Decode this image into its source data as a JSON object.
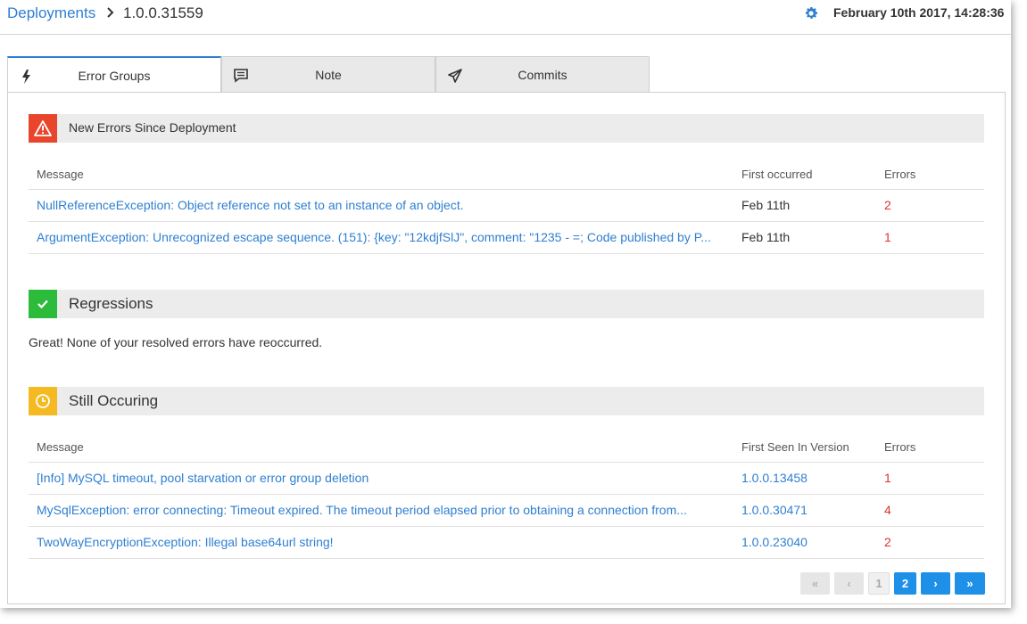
{
  "header": {
    "breadcrumb_root": "Deployments",
    "breadcrumb_current": "1.0.0.31559",
    "settings_icon": "gear-icon",
    "date": "February 10th 2017, 14:28:36"
  },
  "tabs": [
    {
      "label": "Error Groups",
      "icon": "lightning-icon",
      "active": true
    },
    {
      "label": "Note",
      "icon": "comment-icon",
      "active": false
    },
    {
      "label": "Commits",
      "icon": "paper-plane-icon",
      "active": false
    }
  ],
  "new_errors": {
    "title": "New Errors Since Deployment",
    "icon_color": "#e8452c",
    "columns": [
      "Message",
      "First occurred",
      "Errors"
    ],
    "rows": [
      {
        "message": "NullReferenceException: Object reference not set to an instance of an object.",
        "first": "Feb 11th",
        "errors": "2"
      },
      {
        "message": "ArgumentException: Unrecognized escape sequence. (151): {key: \"12kdjfSlJ\", comment: \"1235 - =; Code published by P...",
        "first": "Feb 11th",
        "errors": "1"
      }
    ]
  },
  "regressions": {
    "title": "Regressions",
    "icon_color": "#2dbb3c",
    "message": "Great! None of your resolved errors have reoccurred."
  },
  "still_occuring": {
    "title": "Still Occuring",
    "icon_color": "#f5b922",
    "columns": [
      "Message",
      "First Seen In Version",
      "Errors"
    ],
    "rows": [
      {
        "message": "[Info] MySQL timeout, pool starvation or error group deletion",
        "version": "1.0.0.13458",
        "errors": "1"
      },
      {
        "message": "MySqlException: error connecting: Timeout expired. The timeout period elapsed prior to obtaining a connection from...",
        "version": "1.0.0.30471",
        "errors": "4"
      },
      {
        "message": "TwoWayEncryptionException: Illegal base64url string!",
        "version": "1.0.0.23040",
        "errors": "2"
      }
    ]
  },
  "pagination": {
    "first": "«",
    "prev": "‹",
    "page1": "1",
    "page2": "2",
    "next": "›",
    "last": "»"
  },
  "colors": {
    "accent": "#2f7fd1",
    "error": "#d9352b",
    "pager_active": "#1e90e8"
  }
}
